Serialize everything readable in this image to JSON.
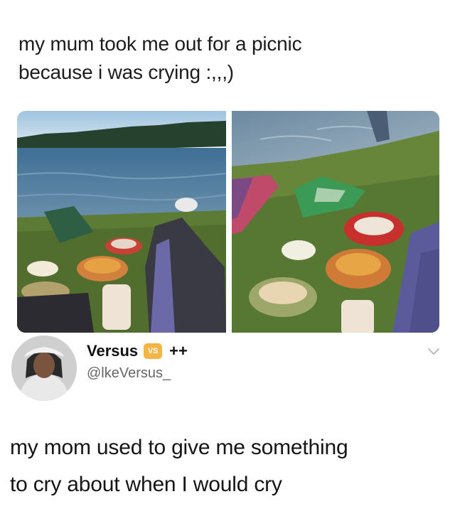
{
  "post": {
    "text_line1": "my mum took me out for a picnic",
    "text_line2": "because i was crying :,,,)"
  },
  "reply": {
    "author_name": "Versus",
    "badge_text": "VS",
    "name_suffix": "++",
    "handle": "@lkeVersus_",
    "text_line1": "my mom used to give me something",
    "text_line2": "to cry about when I would cry"
  },
  "colors": {
    "badge": "#f5b546",
    "text": "#1c1c1c",
    "handle": "#666666"
  },
  "icons": {
    "menu": "chevron-down-icon"
  }
}
